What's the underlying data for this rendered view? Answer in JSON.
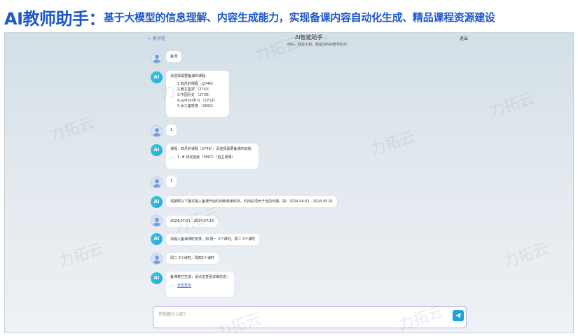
{
  "banner": {
    "main": "AI教师助手：",
    "sub": "基于大模型的信息理解、内容生成能力，实现备课内容自动化生成、精品课程资源建设"
  },
  "header": {
    "back": "← 新对话",
    "title": "AI智能助手",
    "exit": "退出",
    "subtitle": "你好，我是小和，我是你的AI教学助手。"
  },
  "chat": {
    "m1": "备课",
    "m2": {
      "intro": "请选择需要备课的课程：",
      "items": [
        "1.四月的课程  （2746）",
        "2.散文鉴赏  （2743）",
        "3.中国历史  （2739）",
        "4.python学习  （2719）",
        "5.水工建筑物  （1690）"
      ]
    },
    "m3": "1",
    "m4": {
      "intro": "课程：四月的课程（2746），请选择需要备课的班级：",
      "item": "1. # 测试班级（3897）（自主排课）"
    },
    "m5": "1",
    "m6": "请按照以下格式输入备课开始时间和结束时间，时间必须大于当前日期，如：2024.04.01 - 2024.05.01",
    "m7": "2024.07.01 - 2024.07.15",
    "m8": "请输入备课课时安排，如:周一 2个课时，周二 4个课时",
    "m9": "周二 2个课时，周四2个课时",
    "m10": {
      "intro": "备课表已生成，请点击查看详细信息：",
      "link": "点击查看"
    }
  },
  "input": {
    "placeholder": "你想做什么呢?"
  },
  "watermark": "力拓云",
  "colors": {
    "accent": "#1f57c8",
    "send": "#1fa2d8"
  }
}
